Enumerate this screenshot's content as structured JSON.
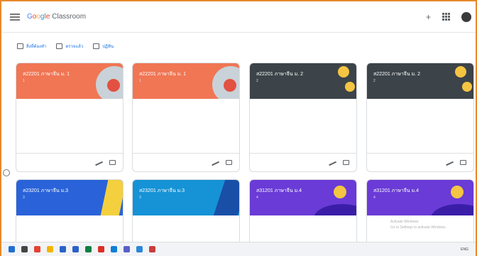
{
  "header": {
    "logo_google": [
      "G",
      "o",
      "o",
      "g",
      "l",
      "e"
    ],
    "logo_classroom": "Classroom",
    "plus_label": "+"
  },
  "subnav": {
    "items": [
      {
        "label": "สิ่งที่ต้องทำ",
        "icon": "assignment-icon"
      },
      {
        "label": "ตรวจแล้ว",
        "icon": "folder-icon"
      },
      {
        "label": "ปฏิทิน",
        "icon": "calendar-icon"
      }
    ]
  },
  "cards": [
    {
      "title": "ส22201 ภาษาจีน ม. 1",
      "sub": "1",
      "color": "#f07654",
      "theme": "orange"
    },
    {
      "title": "ส22201 ภาษาจีน ม. 1",
      "sub": "1",
      "color": "#f07654",
      "theme": "orange"
    },
    {
      "title": "ส22201 ภาษาจีน ม. 2",
      "sub": "2",
      "color": "#3c4449",
      "theme": "dark"
    },
    {
      "title": "ส22201 ภาษาจีน ม. 2",
      "sub": "2",
      "color": "#3c4449",
      "theme": "dark"
    },
    {
      "title": "ส23201 ภาษาจีน ม.3",
      "sub": "3",
      "color": "#2a63d9",
      "theme": "blue"
    },
    {
      "title": "ส23201 ภาษาจีน ม.3",
      "sub": "3",
      "color": "#1593d6",
      "theme": "lightblue"
    },
    {
      "title": "ส31201 ภาษาจีน ม.4",
      "sub": "4",
      "color": "#6a3bd6",
      "theme": "purple"
    },
    {
      "title": "ส31201 ภาษาจีน ม.4",
      "sub": "4",
      "color": "#6a3bd6",
      "theme": "purple"
    }
  ],
  "watermark": {
    "line1": "Activate Windows",
    "line2": "Go to Settings to activate Windows."
  },
  "taskbar": {
    "icons": [
      {
        "name": "start-icon",
        "color": "#1f6fd1"
      },
      {
        "name": "search-icon",
        "color": "#444444"
      },
      {
        "name": "chrome-icon",
        "color": "#e44133"
      },
      {
        "name": "folder-icon",
        "color": "#f2b600"
      },
      {
        "name": "store-icon",
        "color": "#2a62c9"
      },
      {
        "name": "app-icon",
        "color": "#2a62c9"
      },
      {
        "name": "meet-icon",
        "color": "#0b8043"
      },
      {
        "name": "browser-icon",
        "color": "#d93025"
      },
      {
        "name": "edge-icon",
        "color": "#0f7fd6"
      },
      {
        "name": "teams-icon",
        "color": "#5b5fc7"
      },
      {
        "name": "photos-icon",
        "color": "#2a88d8"
      },
      {
        "name": "app2-icon",
        "color": "#c83d3d"
      }
    ],
    "tray_text": "ENG"
  }
}
